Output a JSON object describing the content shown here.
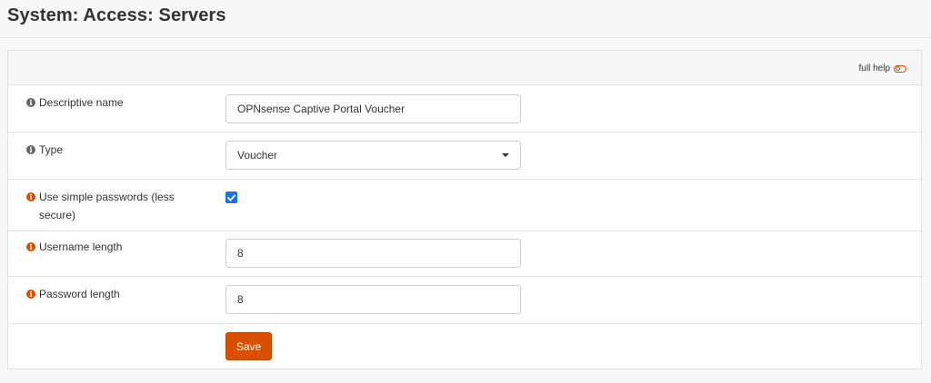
{
  "header": {
    "title": "System: Access: Servers"
  },
  "panel": {
    "full_help_label": "full help"
  },
  "form": {
    "descriptive_name": {
      "label": "Descriptive name",
      "value": "OPNsense Captive Portal Voucher"
    },
    "type": {
      "label": "Type",
      "selected": "Voucher"
    },
    "simple_passwords": {
      "label": "Use simple passwords (less secure)",
      "checked": true
    },
    "username_length": {
      "label": "Username length",
      "value": "8"
    },
    "password_length": {
      "label": "Password length",
      "value": "8"
    },
    "save_label": "Save"
  },
  "colors": {
    "accent": "#d94f00",
    "info_grey": "#666666",
    "checkbox": "#1a73e8"
  },
  "icons": {
    "info": "info-circle-icon",
    "toggle": "toggle-icon",
    "caret": "caret-down-icon",
    "check": "check-icon"
  }
}
